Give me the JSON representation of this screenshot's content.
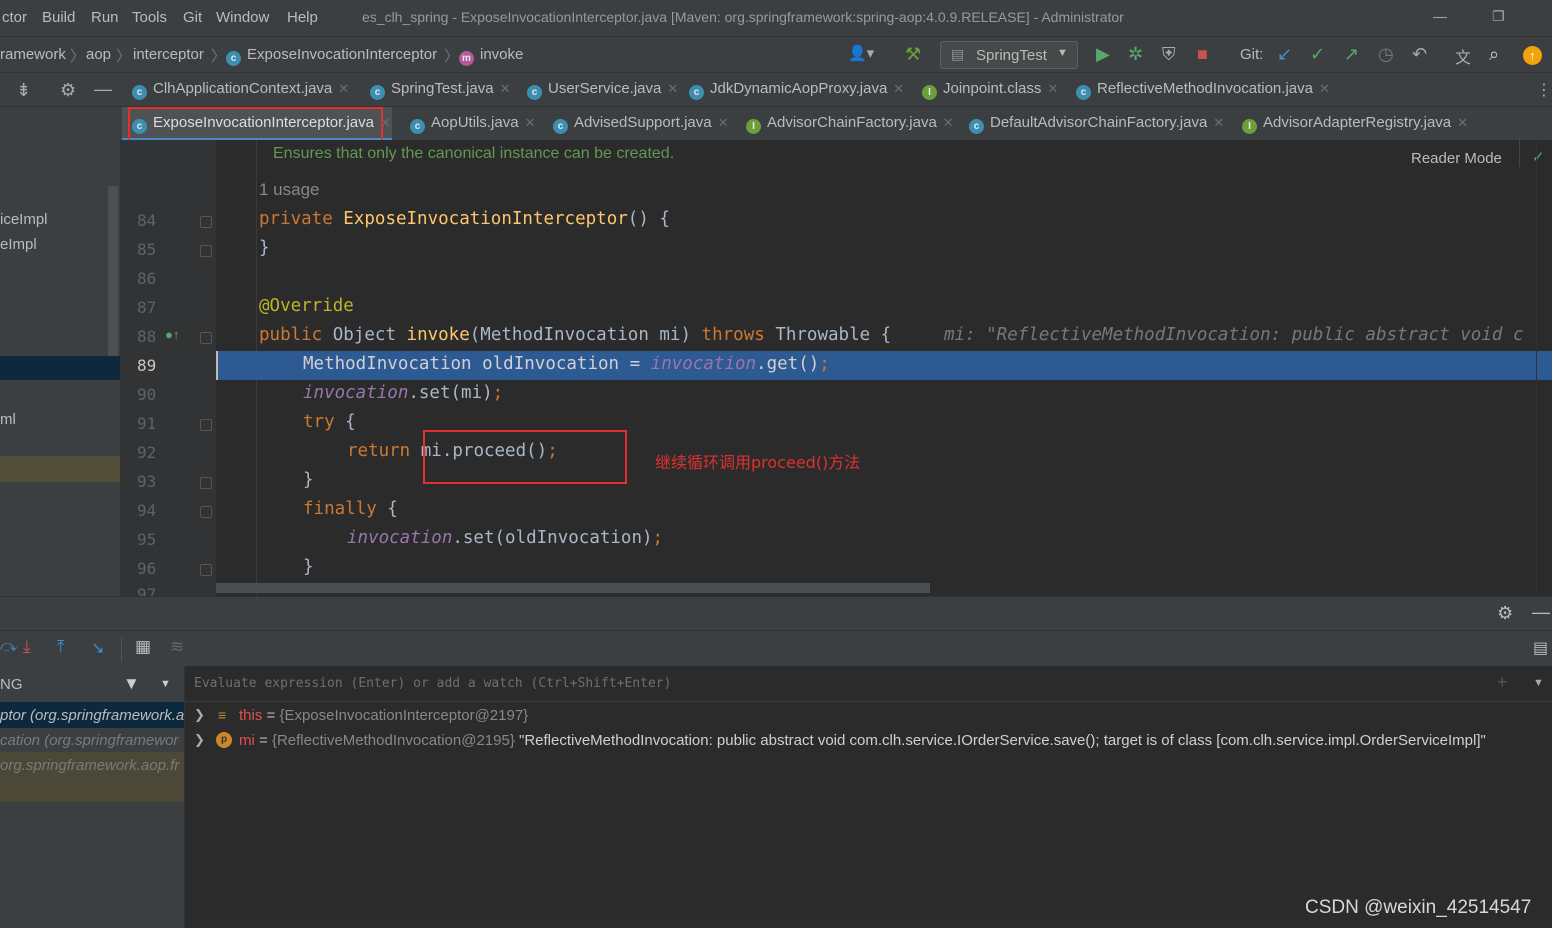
{
  "menu": [
    "ctor",
    "Build",
    "Run",
    "Tools",
    "Git",
    "Window",
    "Help"
  ],
  "window_title": "es_clh_spring - ExposeInvocationInterceptor.java [Maven: org.springframework:spring-aop:4.0.9.RELEASE] - Administrator",
  "breadcrumb": {
    "items": [
      "ramework",
      "aop",
      "interceptor",
      "ExposeInvocationInterceptor",
      "invoke"
    ]
  },
  "toolbar": {
    "run_config": "SpringTest",
    "git_label": "Git:"
  },
  "tabs_row1": [
    {
      "label": "ClhApplicationContext.java",
      "icon": "c"
    },
    {
      "label": "SpringTest.java",
      "icon": "c"
    },
    {
      "label": "UserService.java",
      "icon": "c"
    },
    {
      "label": "JdkDynamicAopProxy.java",
      "icon": "c"
    },
    {
      "label": "Joinpoint.class",
      "icon": "i"
    },
    {
      "label": "ReflectiveMethodInvocation.java",
      "icon": "c"
    }
  ],
  "tabs_row2": [
    {
      "label": "ExposeInvocationInterceptor.java",
      "icon": "c",
      "active": true
    },
    {
      "label": "AopUtils.java",
      "icon": "c"
    },
    {
      "label": "AdvisedSupport.java",
      "icon": "c"
    },
    {
      "label": "AdvisorChainFactory.java",
      "icon": "i"
    },
    {
      "label": "DefaultAdvisorChainFactory.java",
      "icon": "c"
    },
    {
      "label": "AdvisorAdapterRegistry.java",
      "icon": "i"
    }
  ],
  "project_panel": {
    "items": [
      "iceImpl",
      "eImpl",
      "ml"
    ]
  },
  "editor": {
    "reader_mode": "Reader Mode",
    "doc_comment": "Ensures that only the canonical instance can be created.",
    "usage_hint": "1 usage",
    "line_numbers": [
      "84",
      "85",
      "86",
      "87",
      "88",
      "89",
      "90",
      "91",
      "92",
      "93",
      "94",
      "95",
      "96",
      "97"
    ],
    "inline_hint": "mi: \"ReflectiveMethodInvocation: public abstract void c",
    "annotation_text": "继续循环调用proceed()方法",
    "current_line": "89"
  },
  "debugger": {
    "evaluate_placeholder": "Evaluate expression (Enter) or add a watch (Ctrl+Shift+Enter)",
    "frames_header": "NG",
    "frames": [
      "ptor (org.springframework.a",
      "cation (org.springframewor",
      "org.springframework.aop.fr"
    ],
    "variables": [
      {
        "name": "this",
        "value": "{ExposeInvocationInterceptor@2197}",
        "detail": ""
      },
      {
        "name": "mi",
        "value": "{ReflectiveMethodInvocation@2195}",
        "detail": "\"ReflectiveMethodInvocation: public abstract void com.clh.service.IOrderService.save(); target is of class [com.clh.service.impl.OrderServiceImpl]\""
      }
    ]
  },
  "watermark": "CSDN @weixin_42514547",
  "colors": {
    "highlight_line": "#2d5a93",
    "annotation_red": "#e03030",
    "keyword": "#cc7832",
    "function": "#ffc66d"
  }
}
